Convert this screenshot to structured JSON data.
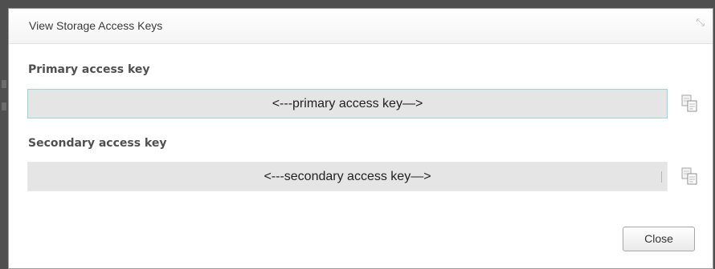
{
  "dialog": {
    "title": "View Storage Access Keys",
    "close_icon": "close-icon"
  },
  "primary": {
    "label": "Primary access key",
    "value": "<---primary access key—>",
    "copy_icon": "copy-icon"
  },
  "secondary": {
    "label": "Secondary access key",
    "value": "<---secondary access key—>",
    "copy_icon": "copy-icon"
  },
  "footer": {
    "close_label": "Close"
  },
  "colors": {
    "backdrop": "#4f4f4f",
    "field_background": "#e5e5e5",
    "focus_border": "#a9cfd6"
  }
}
